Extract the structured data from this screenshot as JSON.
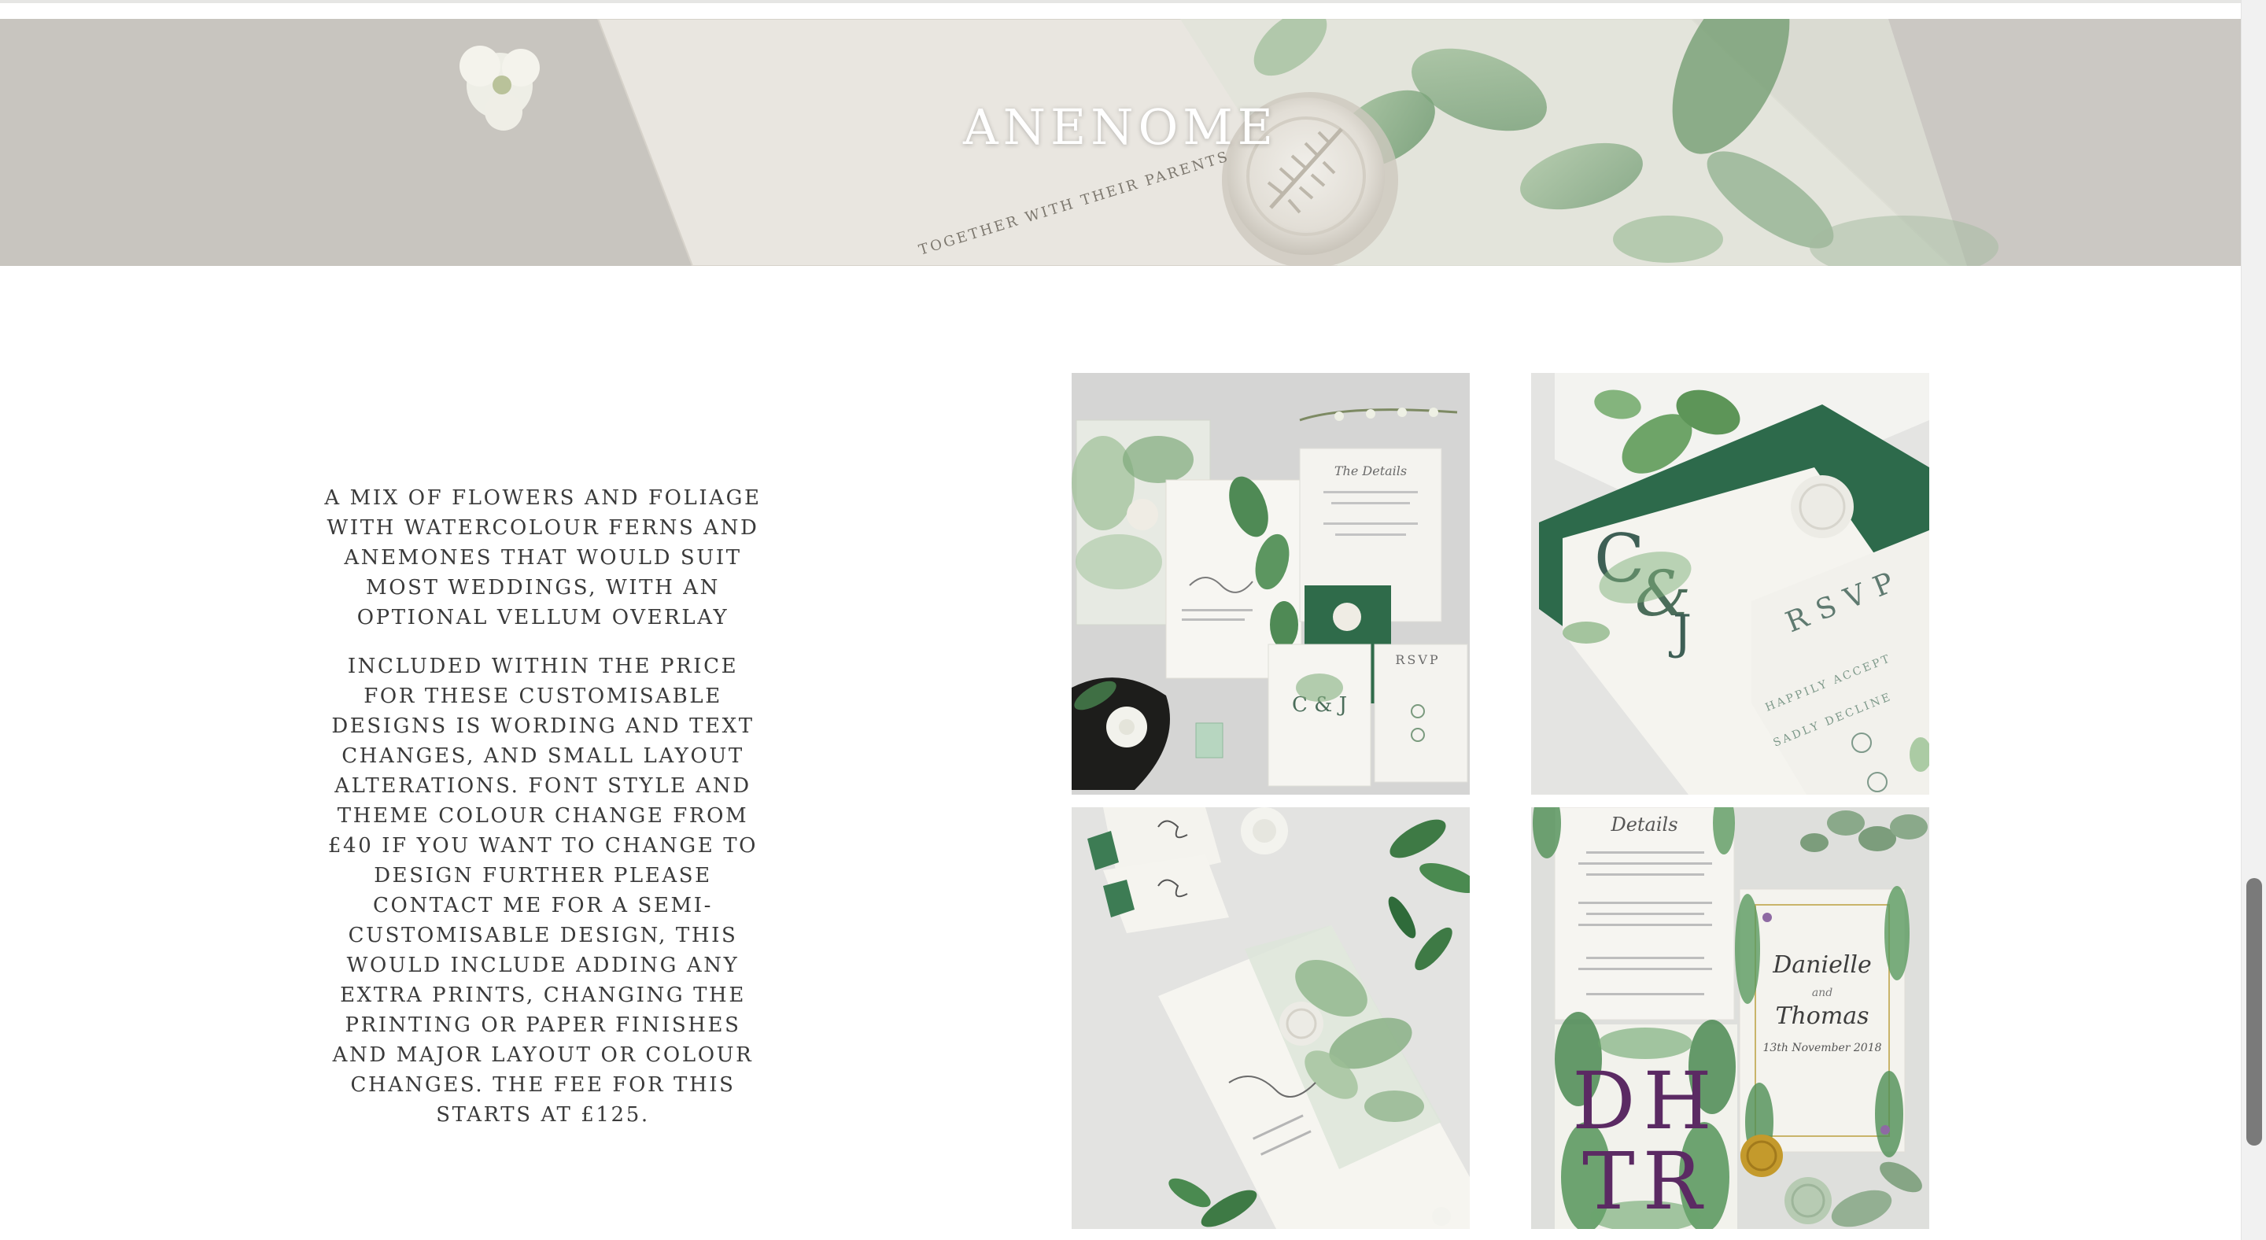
{
  "banner": {
    "title": "ANENOME",
    "stamp_text": "TOGETHER WITH THEIR PARENTS"
  },
  "description": {
    "paragraph_1": "A MIX OF FLOWERS AND FOLIAGE WITH WATERCOLOUR FERNS AND ANEMONES THAT WOULD SUIT MOST WEDDINGS, WITH AN OPTIONAL VELLUM OVERLAY",
    "paragraph_2": "INCLUDED WITHIN THE PRICE FOR THESE CUSTOMISABLE DESIGNS IS WORDING AND TEXT CHANGES, AND SMALL LAYOUT ALTERATIONS. FONT STYLE AND THEME COLOUR CHANGE FROM £40 IF YOU WANT TO CHANGE TO DESIGN FURTHER PLEASE CONTACT ME FOR A SEMI-CUSTOMISABLE DESIGN, THIS WOULD INCLUDE ADDING ANY EXTRA PRINTS, CHANGING THE PRINTING OR PAPER FINISHES AND MAJOR LAYOUT OR COLOUR CHANGES. THE FEE FOR THIS STARTS AT £125."
  },
  "gallery": {
    "tile_1": {
      "details_title": "The Details",
      "monogram": "C & J",
      "rsvp": "RSVP"
    },
    "tile_2": {
      "monogram_c": "C",
      "monogram_amp": "&",
      "monogram_j": "J",
      "rsvp": "RSVP",
      "happily_accept": "HAPPILY ACCEPT",
      "sadly_decline": "SADLY DECLINE"
    },
    "tile_4": {
      "details_title": "Details",
      "couple_line_1": "Danielle",
      "couple_and": "and",
      "couple_line_2": "Thomas",
      "date_line": "13th November 2018",
      "monogram_top": "DH",
      "monogram_bottom": "TR"
    }
  },
  "colors": {
    "banner_title": "#ffffff",
    "text": "#3a3a3a",
    "accent_green": "#2f6b4a",
    "monogram_purple": "#5b2a63",
    "scroll_thumb": "#7a7a7a"
  }
}
